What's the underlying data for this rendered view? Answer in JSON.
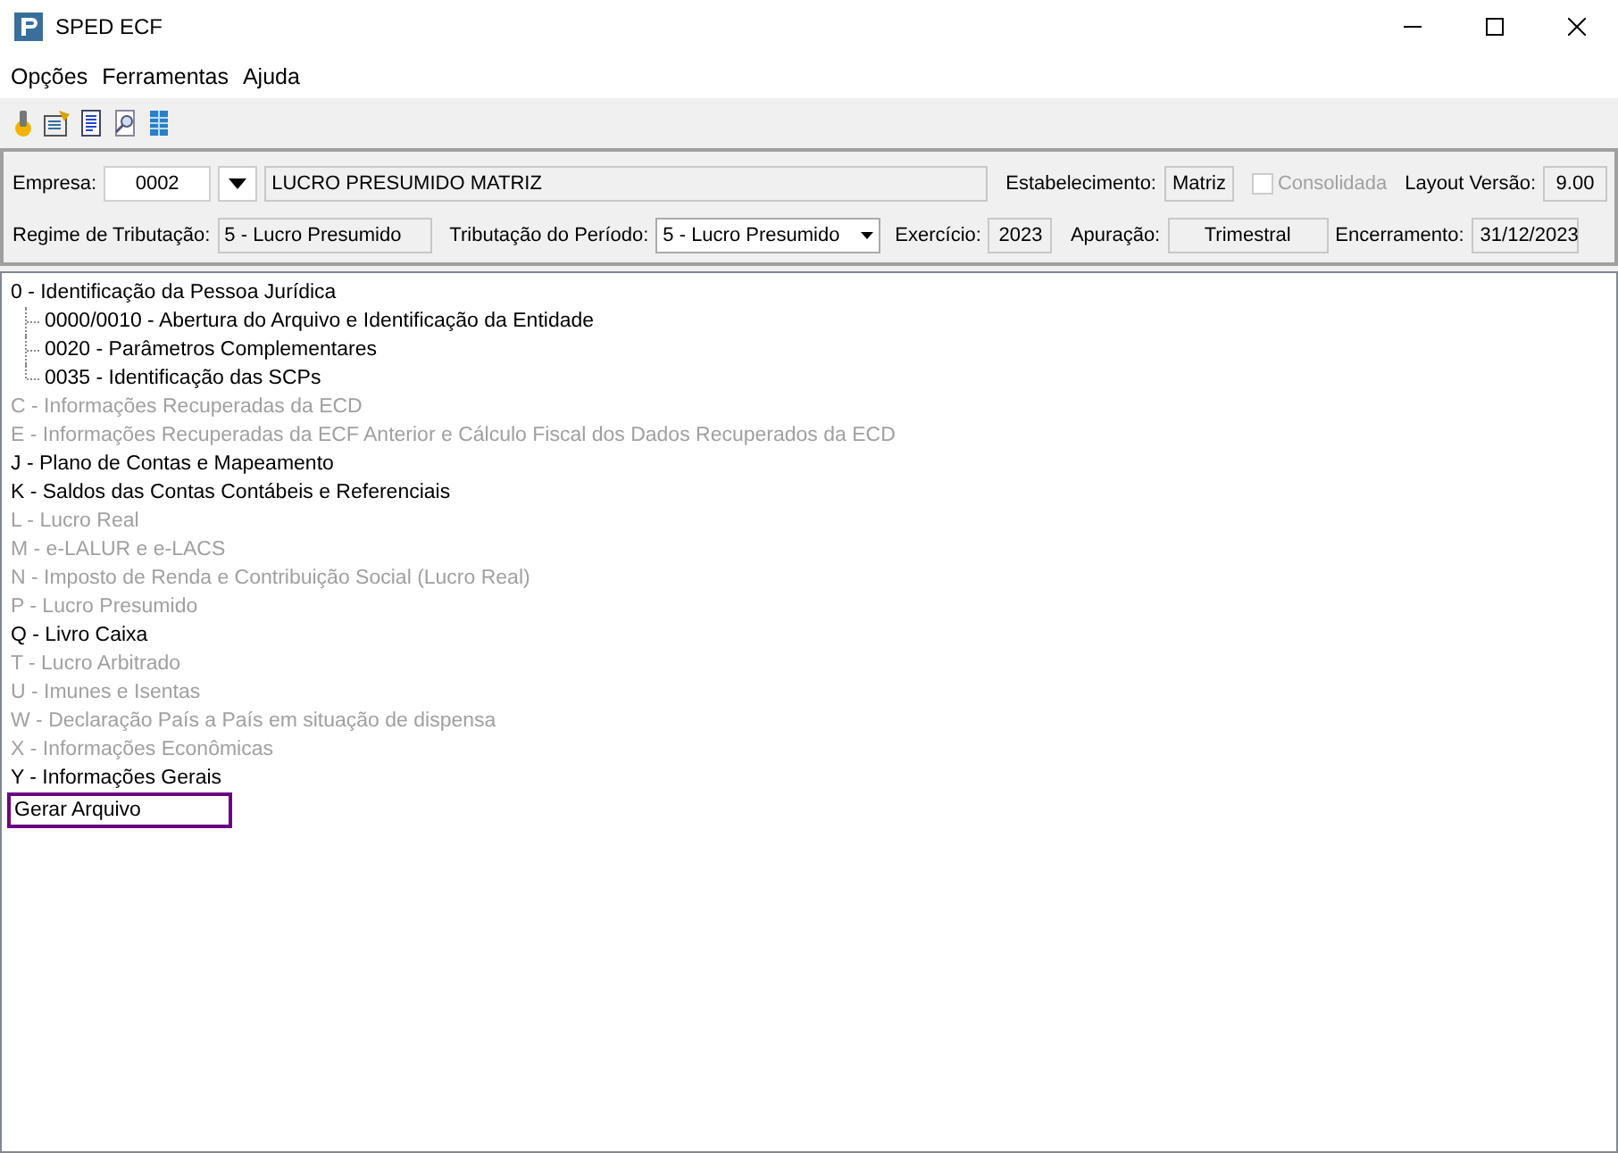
{
  "window": {
    "title": "SPED ECF"
  },
  "menu": [
    "Opções",
    "Ferramentas",
    "Ajuda"
  ],
  "toolbar": [
    {
      "kind": "plug"
    },
    {
      "kind": "settings"
    },
    {
      "kind": "document"
    },
    {
      "kind": "preview"
    },
    {
      "kind": "table"
    }
  ],
  "header": {
    "empresa_label": "Empresa:",
    "empresa_code": "0002",
    "empresa_name": "LUCRO PRESUMIDO MATRIZ",
    "estabelecimento_label": "Estabelecimento:",
    "estabelecimento": "Matriz",
    "consolidada": {
      "label": "Consolidada",
      "checked": false,
      "disabled": true
    },
    "layout_label": "Layout Versão:",
    "layout": "9.00",
    "regime_label": "Regime de Tributação:",
    "regime": "5 - Lucro Presumido",
    "periodo_label": "Tributação do Período:",
    "periodo": "5 - Lucro Presumido",
    "exercicio_label": "Exercício:",
    "exercicio": "2023",
    "apuracao_label": "Apuração:",
    "apuracao": "Trimestral",
    "encerramento_label": "Encerramento:",
    "encerramento": "31/12/2023"
  },
  "tree": [
    {
      "label": "0 - Identificação da Pessoa Jurídica",
      "disabled": false,
      "selected": false,
      "children": [
        {
          "label": "0000/0010 - Abertura do Arquivo e Identificação da Entidade",
          "disabled": false,
          "selected": false
        },
        {
          "label": "0020 - Parâmetros Complementares",
          "disabled": false,
          "selected": false
        },
        {
          "label": "0035 - Identificação das SCPs",
          "disabled": false,
          "selected": false
        }
      ]
    },
    {
      "label": "C - Informações Recuperadas da ECD",
      "disabled": true,
      "selected": false
    },
    {
      "label": "E - Informações Recuperadas da ECF Anterior e Cálculo Fiscal dos Dados Recuperados da ECD",
      "disabled": true,
      "selected": false
    },
    {
      "label": "J - Plano de Contas e Mapeamento",
      "disabled": false,
      "selected": false
    },
    {
      "label": "K - Saldos das Contas Contábeis e Referenciais",
      "disabled": false,
      "selected": false
    },
    {
      "label": "L - Lucro Real",
      "disabled": true,
      "selected": false
    },
    {
      "label": "M - e-LALUR e e-LACS",
      "disabled": true,
      "selected": false
    },
    {
      "label": "N - Imposto de Renda e Contribuição Social (Lucro Real)",
      "disabled": true,
      "selected": false
    },
    {
      "label": "P - Lucro Presumido",
      "disabled": true,
      "selected": false
    },
    {
      "label": "Q - Livro Caixa",
      "disabled": false,
      "selected": false
    },
    {
      "label": "T - Lucro Arbitrado",
      "disabled": true,
      "selected": false
    },
    {
      "label": "U - Imunes e Isentas",
      "disabled": true,
      "selected": false
    },
    {
      "label": "W - Declaração País a País em situação de dispensa",
      "disabled": true,
      "selected": false
    },
    {
      "label": "X - Informações Econômicas",
      "disabled": true,
      "selected": false
    },
    {
      "label": "Y - Informações Gerais",
      "disabled": false,
      "selected": false
    },
    {
      "label": "Gerar Arquivo",
      "disabled": false,
      "selected": true
    }
  ]
}
